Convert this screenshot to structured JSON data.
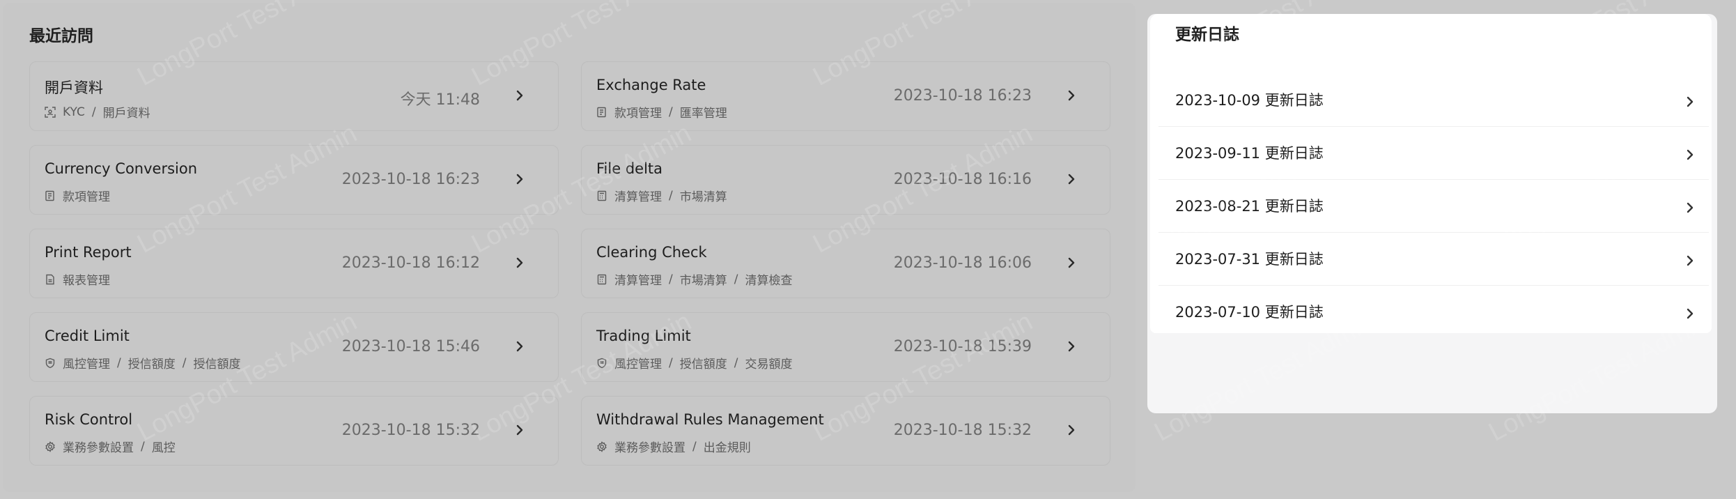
{
  "recent": {
    "title": "最近訪問",
    "cards": [
      {
        "title": "開戶資料",
        "path": [
          "KYC",
          "開戶資料"
        ],
        "time": "今天 11:48",
        "icon": "kyc-scan-icon"
      },
      {
        "title": "Exchange Rate",
        "path": [
          "款項管理",
          "匯率管理"
        ],
        "time": "2023-10-18 16:23",
        "icon": "document-icon"
      },
      {
        "title": "Currency Conversion",
        "path": [
          "款項管理"
        ],
        "time": "2023-10-18 16:23",
        "icon": "document-icon"
      },
      {
        "title": "File delta",
        "path": [
          "清算管理",
          "市場清算"
        ],
        "time": "2023-10-18 16:16",
        "icon": "calculator-icon"
      },
      {
        "title": "Print Report",
        "path": [
          "報表管理"
        ],
        "time": "2023-10-18 16:12",
        "icon": "report-icon"
      },
      {
        "title": "Clearing Check",
        "path": [
          "清算管理",
          "市場清算",
          "清算檢查"
        ],
        "time": "2023-10-18 16:06",
        "icon": "calculator-icon"
      },
      {
        "title": "Credit Limit",
        "path": [
          "風控管理",
          "授信額度",
          "授信額度"
        ],
        "time": "2023-10-18 15:46",
        "icon": "shield-icon"
      },
      {
        "title": "Trading Limit",
        "path": [
          "風控管理",
          "授信額度",
          "交易額度"
        ],
        "time": "2023-10-18 15:39",
        "icon": "shield-icon"
      },
      {
        "title": "Risk Control",
        "path": [
          "業務參數設置",
          "風控"
        ],
        "time": "2023-10-18 15:32",
        "icon": "gear-icon"
      },
      {
        "title": "Withdrawal Rules Management",
        "path": [
          "業務參數設置",
          "出金規則"
        ],
        "time": "2023-10-18 15:32",
        "icon": "gear-icon"
      }
    ]
  },
  "changelog": {
    "title": "更新日誌",
    "items": [
      "2023-10-09 更新日誌",
      "2023-09-11 更新日誌",
      "2023-08-21 更新日誌",
      "2023-07-31 更新日誌",
      "2023-07-10 更新日誌"
    ]
  },
  "watermark": "LongPort Test Admin",
  "colors": {
    "overlay": "#c7c7c7",
    "panel": "#ffffff",
    "text": "#1d1d1d",
    "muted": "#6b6b6b"
  }
}
